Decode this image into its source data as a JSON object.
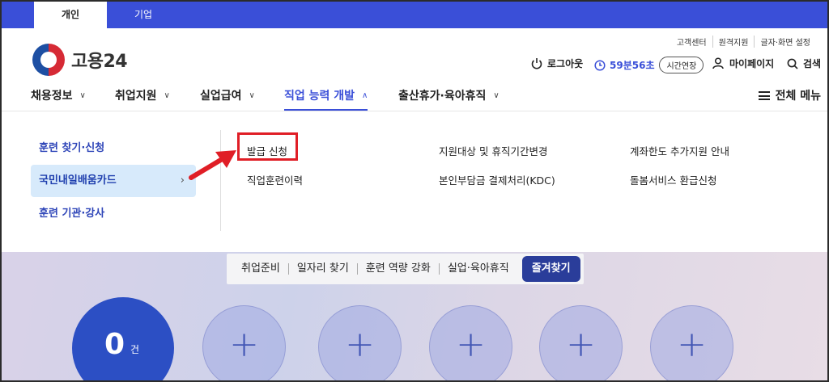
{
  "user_tabs": [
    {
      "label": "개인"
    },
    {
      "label": "기업"
    }
  ],
  "brand": {
    "name": "고용24"
  },
  "utility_links": [
    {
      "label": "고객센터"
    },
    {
      "label": "원격지원"
    },
    {
      "label": "글자·화면 설정"
    }
  ],
  "account": {
    "logout_label": "로그아웃",
    "session_timer": "59분56초",
    "extend_label": "시간연장",
    "mypage_label": "마이페이지",
    "search_label": "검색"
  },
  "gnb": {
    "items": [
      {
        "label": "채용정보",
        "active": false
      },
      {
        "label": "취업지원",
        "active": false
      },
      {
        "label": "실업급여",
        "active": false
      },
      {
        "label": "직업 능력 개발",
        "active": true
      },
      {
        "label": "출산휴가·육아휴직",
        "active": false
      }
    ],
    "all_menu_label": "전체 메뉴"
  },
  "dropdown": {
    "left_menu": [
      {
        "label": "훈련 찾기·신청"
      },
      {
        "label": "국민내일배움카드",
        "selected": true,
        "arrow": "›"
      },
      {
        "label": "훈련 기관·강사"
      }
    ],
    "submenu": [
      {
        "label": "발급 신청",
        "highlighted": true
      },
      {
        "label": "직업훈련이력"
      },
      {
        "label": "지원대상 및 휴직기간변경"
      },
      {
        "label": "본인부담금 결제처리(KDC)"
      },
      {
        "label": "계좌한도 추가지원 안내"
      },
      {
        "label": "돌봄서비스 환급신청"
      }
    ]
  },
  "quick_bar": {
    "items": [
      {
        "label": "취업준비"
      },
      {
        "label": "일자리 찾기"
      },
      {
        "label": "훈련 역량 강화"
      },
      {
        "label": "실업·육아휴직"
      }
    ],
    "favorites_label": "즐겨찾기"
  },
  "favorites_count": {
    "value": "0",
    "unit": "건"
  },
  "annotation": {
    "box_color": "#e01e26",
    "arrow_color": "#e01e26"
  },
  "colors": {
    "primary": "#3a4fd8",
    "selected_bg": "#d7eafb",
    "count_circle": "#2c4fc4"
  }
}
